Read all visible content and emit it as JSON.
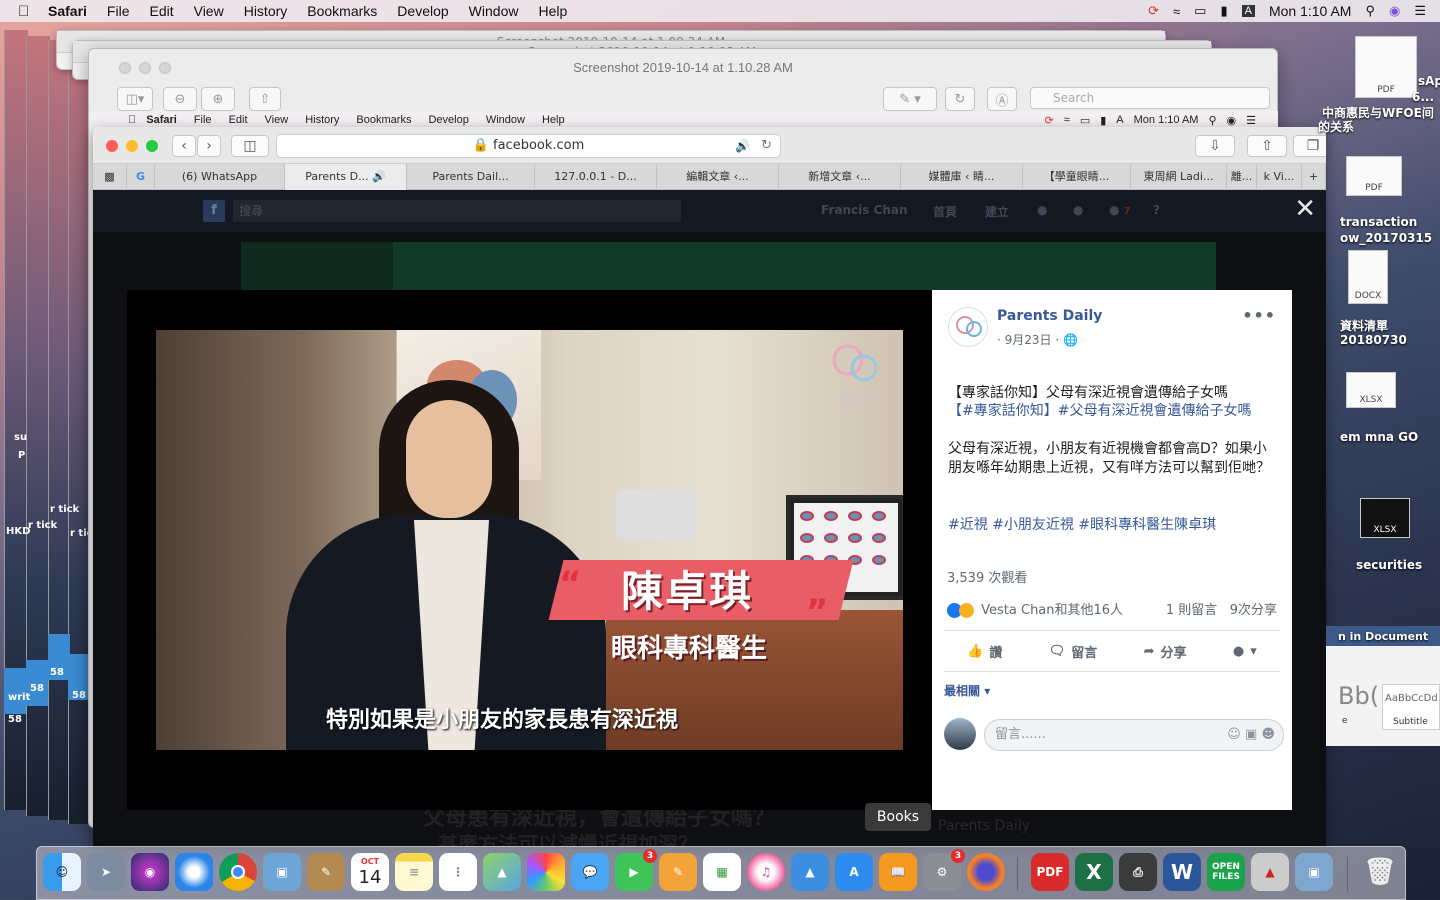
{
  "menubar": {
    "app": "Safari",
    "items": [
      "File",
      "Edit",
      "View",
      "History",
      "Bookmarks",
      "Develop",
      "Window",
      "Help"
    ],
    "clock": "Mon 1:10 AM"
  },
  "bg_windows": {
    "title1": "Screenshot 2019-10-14 at 1.09.34 AM",
    "title2": "Screenshot 2019-10-14 at 1.10.08 AM"
  },
  "preview": {
    "title": "Screenshot 2019-10-14 at 1.10.28 AM",
    "search_placeholder": "Search",
    "inner_app": "Safari",
    "inner_items": [
      "File",
      "Edit",
      "View",
      "History",
      "Bookmarks",
      "Develop",
      "Window",
      "Help"
    ],
    "inner_clock": "Mon 1:10 AM"
  },
  "safari": {
    "url": "facebook.com",
    "tabs": [
      "(6) WhatsApp",
      "Parents D...",
      "Parents Dail...",
      "127.0.0.1 - D...",
      "編輯文章 ‹...",
      "新增文章 ‹...",
      "媒體庫 ‹ 睛...",
      "【學童眼睛...",
      "東周網 Ladi...",
      "離...",
      "k Vi..."
    ]
  },
  "facebook": {
    "search_placeholder": "搜尋",
    "user_name": "Francis Chan",
    "nav_home": "首頁",
    "nav_create": "建立",
    "notif_count": "7",
    "bg_heading1": "父母患有深近視，會遺傳給子女嗎？",
    "bg_heading2": "甚麼方法可以減慢近視加深？",
    "bg_page_name": "Parents Daily"
  },
  "video": {
    "name_overlay": "陳卓琪",
    "title_overlay": "眼科專科醫生",
    "subtitle": "特別如果是小朋友的家長患有深近視",
    "logo_text": "PARENTS DAILY"
  },
  "post": {
    "page_name": "Parents Daily",
    "date": "· 9月23日 ·",
    "headline": "【專家話你知】父母有深近視會遺傳給子女嗎",
    "hashtag_line_1": "【",
    "hashtag_line_tag1": "#專家話你知",
    "hashtag_line_2": "】",
    "hashtag_line_tag2": "#父母有深近視會遺傳給子女嗎",
    "body": "父母有深近視，小朋友有近視機會都會高D？如果小朋友喺年幼期患上近視，又有咩方法可以幫到佢哋？",
    "tags": [
      "#近視",
      "#小朋友近視",
      "#眼科專科醫生陳卓琪"
    ],
    "views": "3,539 次觀看",
    "reactions_text": "Vesta Chan和其他16人",
    "comments_count": "1 則留言",
    "shares_count": "9次分享",
    "action_like": "讚",
    "action_comment": "留言",
    "action_share": "分享",
    "relevance": "最相關",
    "comment_placeholder": "留言......"
  },
  "desktop": {
    "labels": [
      "PDF",
      "sApp",
      "6...",
      "中商惠民与WFOE间",
      "的关系",
      "PDF",
      "transaction",
      "ow_20170315",
      "DOCX",
      "資料清單",
      "20180730",
      "XLSX",
      "em mna GO",
      "XLSX",
      "securities",
      "n in Document",
      "AaBbCcDd",
      "Subtitle",
      "Bb(",
      "e"
    ],
    "left_labels": [
      "su",
      "P",
      "r tick",
      "HKD",
      "writ",
      "58"
    ]
  },
  "dock": {
    "tooltip": "Books",
    "calendar_month": "OCT",
    "calendar_day": "14",
    "badge_facetime": "3",
    "badge_prefs": "3",
    "label_pdf": "PDF",
    "label_open": "OPEN FILES",
    "label_excel": "X",
    "label_word": "W"
  },
  "colors": {
    "fb_blue": "#385898",
    "accent_red": "#e85d66"
  }
}
